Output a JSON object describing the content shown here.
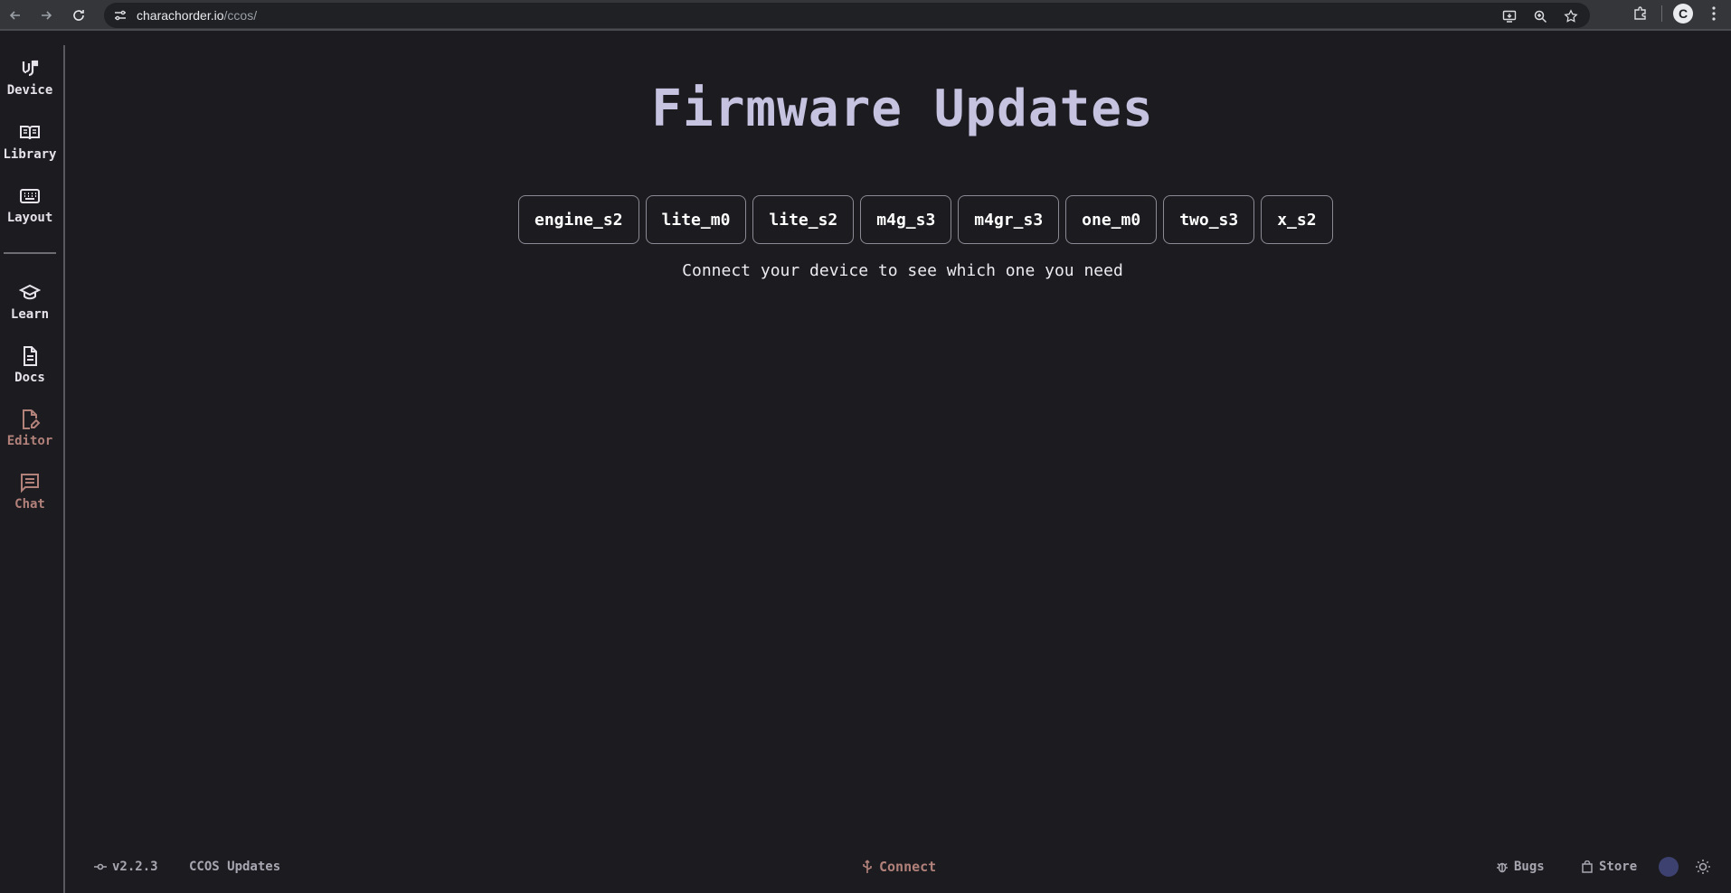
{
  "browser": {
    "url_host": "charachorder.io",
    "url_path": "/ccos/"
  },
  "sidebar": {
    "items": [
      {
        "label": "Device",
        "icon": "device-icon"
      },
      {
        "label": "Library",
        "icon": "book-icon"
      },
      {
        "label": "Layout",
        "icon": "keyboard-icon"
      },
      {
        "label": "Learn",
        "icon": "graduation-cap-icon"
      },
      {
        "label": "Docs",
        "icon": "document-icon"
      },
      {
        "label": "Editor",
        "icon": "edit-document-icon"
      },
      {
        "label": "Chat",
        "icon": "chat-icon"
      }
    ]
  },
  "main": {
    "title": "Firmware Updates",
    "firmware_buttons": [
      "engine_s2",
      "lite_m0",
      "lite_s2",
      "m4g_s3",
      "m4gr_s3",
      "one_m0",
      "two_s3",
      "x_s2"
    ],
    "hint": "Connect your device to see which one you need"
  },
  "footer": {
    "version": "v2.2.3",
    "updates": "CCOS Updates",
    "connect": "Connect",
    "bugs": "Bugs",
    "store": "Store"
  },
  "colors": {
    "background": "#1c1b20",
    "title": "#c5c3e0",
    "dim_accent": "#b1817a"
  }
}
